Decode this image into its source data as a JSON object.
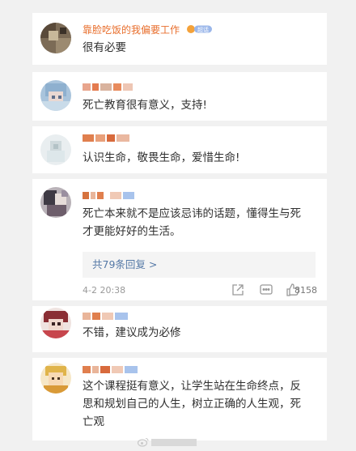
{
  "comments": [
    {
      "username": "靠脸吃饭的我偏要工作",
      "badge": "超话",
      "text": "很有必要"
    },
    {
      "username": "",
      "text": "死亡教育很有意义，支持!"
    },
    {
      "username": "",
      "text": "认识生命，敬畏生命，爱惜生命!"
    },
    {
      "username": "",
      "text_line1": "死亡本来就不是应该忌讳的话题，懂得生与死",
      "text_line2": "才更能好好的生活。",
      "replies_label": "共79条回复 >",
      "time": "4-2 20:38",
      "likes": "8158"
    },
    {
      "username": "",
      "text": "不错，建议成为必修"
    },
    {
      "username": "",
      "text_line1": "这个课程挺有意义，让学生站在生命终点，反",
      "text_line2": "思和规划自己的人生，树立正确的人生观，死",
      "text_line3": "亡观"
    }
  ],
  "icons": {
    "share": "share-icon",
    "comment": "comment-icon",
    "like": "thumb-up-icon"
  },
  "colors": {
    "username": "#e86e2c",
    "link": "#5478a6",
    "background": "#f1f1f1"
  }
}
